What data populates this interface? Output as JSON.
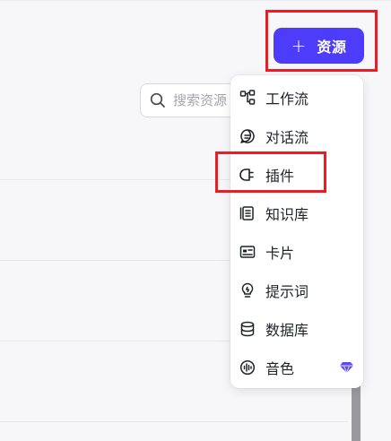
{
  "header": {
    "add_button": {
      "icon": "plus-icon",
      "plus_glyph": "+",
      "label": "资源"
    }
  },
  "search": {
    "icon": "search-icon",
    "placeholder": "搜索资源"
  },
  "menu": {
    "items": [
      {
        "label": "工作流",
        "icon": "workflow-icon"
      },
      {
        "label": "对话流",
        "icon": "chat-flow-icon"
      },
      {
        "label": "插件",
        "icon": "plugin-icon"
      },
      {
        "label": "知识库",
        "icon": "knowledge-base-icon"
      },
      {
        "label": "卡片",
        "icon": "card-icon"
      },
      {
        "label": "提示词",
        "icon": "prompt-icon"
      },
      {
        "label": "数据库",
        "icon": "database-icon"
      },
      {
        "label": "音色",
        "icon": "voice-icon",
        "badge": "premium-diamond-icon"
      }
    ]
  },
  "colors": {
    "accent": "#4d3dfb",
    "highlight_box": "#ec1c24",
    "premium_badge": "#5b4cf5"
  }
}
